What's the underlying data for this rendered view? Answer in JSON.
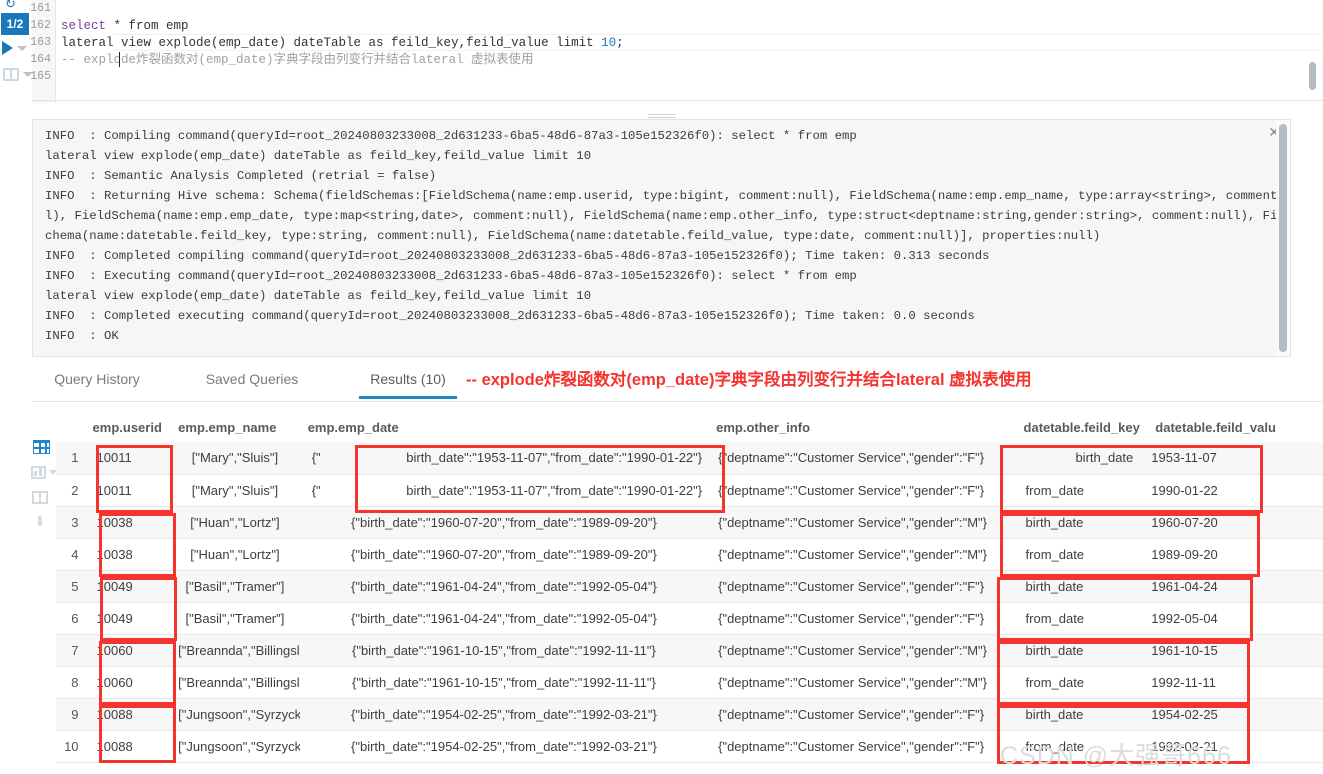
{
  "editor": {
    "page_badge": "1/2",
    "line_numbers": [
      "161",
      "162",
      "163",
      "164",
      "165"
    ],
    "lines": [
      {
        "n": "161",
        "text": ""
      },
      {
        "n": "162",
        "text": "select * from emp"
      },
      {
        "n": "163",
        "text": "lateral view explode(emp_date) dateTable as feild_key,feild_value limit 10;"
      },
      {
        "n": "164",
        "text": "-- explode炸裂函数对(emp_date)字典字段由列变行并结合lateral 虚拟表使用"
      },
      {
        "n": "165",
        "text": ""
      }
    ],
    "code": {
      "l162_kw": "select",
      "l162_rest": " * from emp",
      "l163_a": "lateral view explode(emp_date) dateTable as feild_key,feild_value limit ",
      "l163_num": "10",
      "l163_end": ";",
      "l164_comment": "-- explode炸裂函数对(emp_date)字典字段由列变行并结合lateral 虚拟表使用"
    }
  },
  "log": {
    "close_label": "✕",
    "text": "INFO  : Compiling command(queryId=root_20240803233008_2d631233-6ba5-48d6-87a3-105e152326f0): select * from emp\nlateral view explode(emp_date) dateTable as feild_key,feild_value limit 10\nINFO  : Semantic Analysis Completed (retrial = false)\nINFO  : Returning Hive schema: Schema(fieldSchemas:[FieldSchema(name:emp.userid, type:bigint, comment:null), FieldSchema(name:emp.emp_name, type:array<string>, comment:nul\nl), FieldSchema(name:emp.emp_date, type:map<string,date>, comment:null), FieldSchema(name:emp.other_info, type:struct<deptname:string,gender:string>, comment:null), FieldS\nchema(name:datetable.feild_key, type:string, comment:null), FieldSchema(name:datetable.feild_value, type:date, comment:null)], properties:null)\nINFO  : Completed compiling command(queryId=root_20240803233008_2d631233-6ba5-48d6-87a3-105e152326f0); Time taken: 0.313 seconds\nINFO  : Executing command(queryId=root_20240803233008_2d631233-6ba5-48d6-87a3-105e152326f0): select * from emp\nlateral view explode(emp_date) dateTable as feild_key,feild_value limit 10\nINFO  : Completed executing command(queryId=root_20240803233008_2d631233-6ba5-48d6-87a3-105e152326f0); Time taken: 0.0 seconds\nINFO  : OK"
  },
  "tabs": {
    "query_history": "Query History",
    "saved_queries": "Saved Queries",
    "results": "Results (10)"
  },
  "annotation": "-- explode炸裂函数对(emp_date)字典字段由列变行并结合lateral 虚拟表使用",
  "results_table": {
    "columns": [
      "",
      "emp.userid",
      "emp.emp_name",
      "emp.emp_date",
      "emp.other_info",
      "datetable.feild_key",
      "datetable.feild_valu"
    ],
    "rows": [
      {
        "n": "1",
        "userid": "10011",
        "emp_name": "[\"Mary\",\"Sluis\"]",
        "emp_date": "{\"                 birth_date\":\"1953-11-07\",\"from_date\":\"1990-01-22\"}",
        "other_info": "{\"deptname\":\"Customer Service\",\"gender\":\"F\"}",
        "feild_key": "birth_date",
        "feild_value": "1953-11-07"
      },
      {
        "n": "2",
        "userid": "10011",
        "emp_name": "[\"Mary\",\"Sluis\"]",
        "emp_date": "{\"                 birth_date\":\"1953-11-07\",\"from_date\":\"1990-01-22\"}",
        "other_info": "{\"deptname\":\"Customer Service\",\"gender\":\"F\"}",
        "feild_key": "from_date",
        "feild_value": "1990-01-22"
      },
      {
        "n": "3",
        "userid": "10038",
        "emp_name": "[\"Huan\",\"Lortz\"]",
        "emp_date": "{\"birth_date\":\"1960-07-20\",\"from_date\":\"1989-09-20\"}",
        "other_info": "{\"deptname\":\"Customer Service\",\"gender\":\"M\"}",
        "feild_key": "birth_date",
        "feild_value": "1960-07-20"
      },
      {
        "n": "4",
        "userid": "10038",
        "emp_name": "[\"Huan\",\"Lortz\"]",
        "emp_date": "{\"birth_date\":\"1960-07-20\",\"from_date\":\"1989-09-20\"}",
        "other_info": "{\"deptname\":\"Customer Service\",\"gender\":\"M\"}",
        "feild_key": "from_date",
        "feild_value": "1989-09-20"
      },
      {
        "n": "5",
        "userid": "10049",
        "emp_name": "[\"Basil\",\"Tramer\"]",
        "emp_date": "{\"birth_date\":\"1961-04-24\",\"from_date\":\"1992-05-04\"}",
        "other_info": "{\"deptname\":\"Customer Service\",\"gender\":\"F\"}",
        "feild_key": "birth_date",
        "feild_value": "1961-04-24"
      },
      {
        "n": "6",
        "userid": "10049",
        "emp_name": "[\"Basil\",\"Tramer\"]",
        "emp_date": "{\"birth_date\":\"1961-04-24\",\"from_date\":\"1992-05-04\"}",
        "other_info": "{\"deptname\":\"Customer Service\",\"gender\":\"F\"}",
        "feild_key": "from_date",
        "feild_value": "1992-05-04"
      },
      {
        "n": "7",
        "userid": "10060",
        "emp_name": "[\"Breannda\",\"Billingsley\"]",
        "emp_date": "{\"birth_date\":\"1961-10-15\",\"from_date\":\"1992-11-11\"}",
        "other_info": "{\"deptname\":\"Customer Service\",\"gender\":\"M\"}",
        "feild_key": "birth_date",
        "feild_value": "1961-10-15"
      },
      {
        "n": "8",
        "userid": "10060",
        "emp_name": "[\"Breannda\",\"Billingsley\"]",
        "emp_date": "{\"birth_date\":\"1961-10-15\",\"from_date\":\"1992-11-11\"}",
        "other_info": "{\"deptname\":\"Customer Service\",\"gender\":\"M\"}",
        "feild_key": "from_date",
        "feild_value": "1992-11-11"
      },
      {
        "n": "9",
        "userid": "10088",
        "emp_name": "[\"Jungsoon\",\"Syrzycki\"]",
        "emp_date": "{\"birth_date\":\"1954-02-25\",\"from_date\":\"1992-03-21\"}",
        "other_info": "{\"deptname\":\"Customer Service\",\"gender\":\"F\"}",
        "feild_key": "birth_date",
        "feild_value": "1954-02-25"
      },
      {
        "n": "10",
        "userid": "10088",
        "emp_name": "[\"Jungsoon\",\"Syrzycki\"]",
        "emp_date": "{\"birth_date\":\"1954-02-25\",\"from_date\":\"1992-03-21\"}",
        "other_info": "{\"deptname\":\"Customer Service\",\"gender\":\"F\"}",
        "feild_key": "from_date",
        "feild_value": "1992-03-21"
      }
    ]
  },
  "watermark": "CSDN @大强哥666",
  "colors": {
    "accent": "#1e87c4",
    "annotation_red": "#f5332f",
    "log_bg": "#f6f6f6"
  }
}
